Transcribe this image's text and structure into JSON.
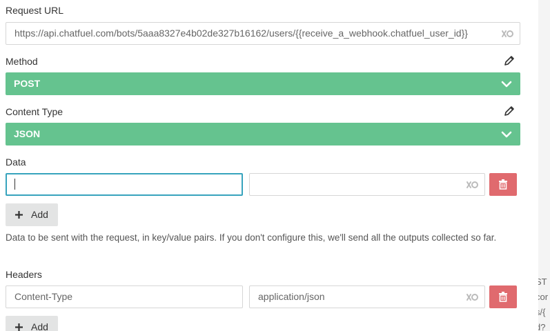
{
  "request_url": {
    "label": "Request URL",
    "value": "https://api.chatfuel.com/bots/5aaa8327e4b02de327b16162/users/{{receive_a_webhook.chatfuel_user_id}}"
  },
  "method": {
    "label": "Method",
    "selected": "POST"
  },
  "content_type": {
    "label": "Content Type",
    "selected": "JSON"
  },
  "data": {
    "label": "Data",
    "key_value": "",
    "value_value": "",
    "add_label": "Add",
    "help_text": "Data to be sent with the request, in key/value pairs. If you don't configure this, we'll send all the outputs collected so far."
  },
  "headers": {
    "label": "Headers",
    "key_value": "Content-Type",
    "value_value": "application/json",
    "add_label": "Add"
  },
  "background_text": {
    "lines": [
      "ST",
      "cor",
      "s/{",
      "d?"
    ]
  },
  "colors": {
    "select_green": "#65c38f",
    "delete_red": "#e06a6e",
    "focus_blue": "#36a3bd"
  }
}
